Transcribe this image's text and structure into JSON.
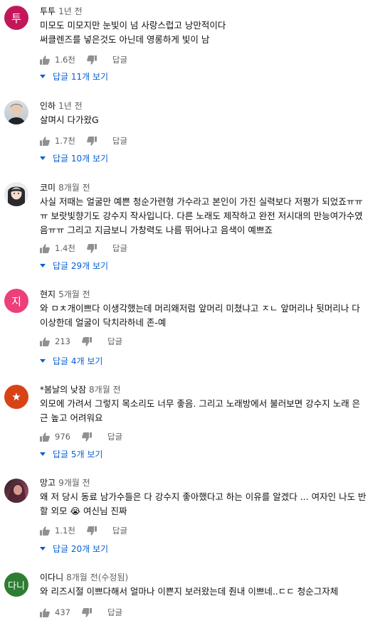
{
  "comments": [
    {
      "avatar_letter": "투",
      "avatar_color": "#c2185b",
      "author": "투투",
      "time": "1년 전",
      "lines": [
        "미모도 미모지만 눈빛이 넘 사랑스럽고 낭만적이다",
        "써클렌즈를 넣은것도 아닌데 영롱하게 빛이 남"
      ],
      "likes": "1.6천",
      "reply_label": "답글",
      "replies": "답글 11개 보기"
    },
    {
      "avatar_letter": "",
      "author": "인하",
      "time": "1년 전",
      "lines": [
        "살며시 다가왔G"
      ],
      "likes": "1.7천",
      "reply_label": "답글",
      "replies": "답글 10개 보기"
    },
    {
      "avatar_letter": "",
      "author": "코미",
      "time": "8개월 전",
      "lines": [
        "사실 저때는 얼굴만 예쁜 청순가련형 가수라고 본인이 가진 실력보다 저평가 되었죠ㅠㅠ",
        "ㅠ 보랏빛향기도 강수지 작사입니다. 다른 노래도 제작하고 완전 저시대의 만능여가수였",
        "음ㅠㅠ 그리고 지금보니 가창력도 나름 뛰어나고 음색이 예쁘죠"
      ],
      "likes": "1.4천",
      "reply_label": "답글",
      "replies": "답글 29개 보기"
    },
    {
      "avatar_letter": "지",
      "avatar_color": "#ec407a",
      "author": "현지",
      "time": "5개월 전",
      "lines": [
        "와 ㅁㅊ개이쁘다 이생각했는데 머리왜저럼 앞머리 미쳤냐고 ㅈㄴ 앞머리나 뒷머리나 다",
        "이상한데 얼굴이 닥치라하네 존-예"
      ],
      "likes": "213",
      "reply_label": "답글",
      "replies": "답글 4개 보기"
    },
    {
      "avatar_letter": "★",
      "avatar_color": "#d84315",
      "author": "*봄날의 낮잠",
      "time": "8개월 전",
      "lines": [
        "외모에 가려서 그렇지 목소리도 너무 좋음. 그리고 노래방에서 불러보면 강수지 노래 은",
        "근 높고 어려워요"
      ],
      "likes": "976",
      "reply_label": "답글",
      "replies": "답글 5개 보기"
    },
    {
      "avatar_letter": "",
      "author": "망고",
      "time": "9개월 전",
      "lines": [
        "왜 저 당시 동료 남가수들은 다 강수지 좋아했다고 하는 이유를 알겠다 ... 여자인 나도 반",
        "할 외모 😭 여신님 진짜"
      ],
      "likes": "1.1천",
      "reply_label": "답글",
      "replies": "답글 20개 보기"
    },
    {
      "avatar_letter": "다니",
      "avatar_color": "#2e7d32",
      "author": "이다니",
      "time": "8개월 전(수정됨)",
      "lines": [
        "와 리즈시절 이쁘다해서 얼마나 이쁜지 보러왔는데 줜내 이쁘네..ㄷㄷ 청순그자체"
      ],
      "likes": "437",
      "reply_label": "답글"
    }
  ]
}
